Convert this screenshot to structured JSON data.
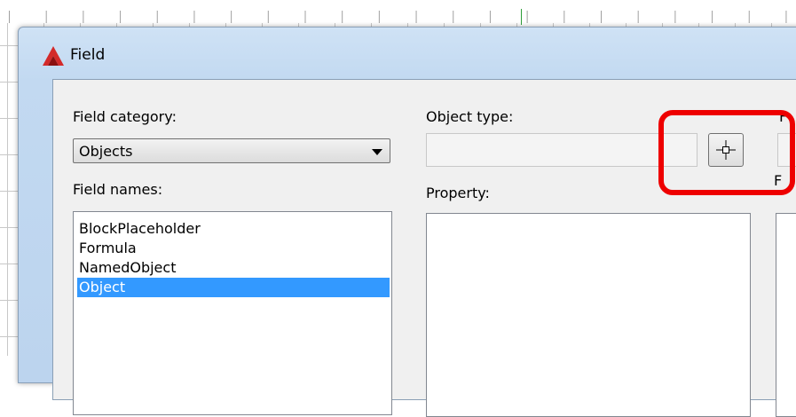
{
  "dialog": {
    "title": "Field",
    "logo_icon": "autocad-logo-icon"
  },
  "field_category": {
    "label": "Field category:",
    "value": "Objects"
  },
  "field_names": {
    "label": "Field names:",
    "items": [
      "BlockPlaceholder",
      "Formula",
      "NamedObject",
      "Object"
    ],
    "selected": "Object"
  },
  "object_type": {
    "label": "Object type:",
    "value": "",
    "pick_button_icon": "crosshair-select-object-icon"
  },
  "property": {
    "label": "Property:"
  },
  "right_column": {
    "label_top": "F",
    "label_bottom": "F"
  },
  "colors": {
    "highlight": "#ee0000",
    "selection": "#3399ff",
    "ruler_marker": "#2e9e3a"
  }
}
